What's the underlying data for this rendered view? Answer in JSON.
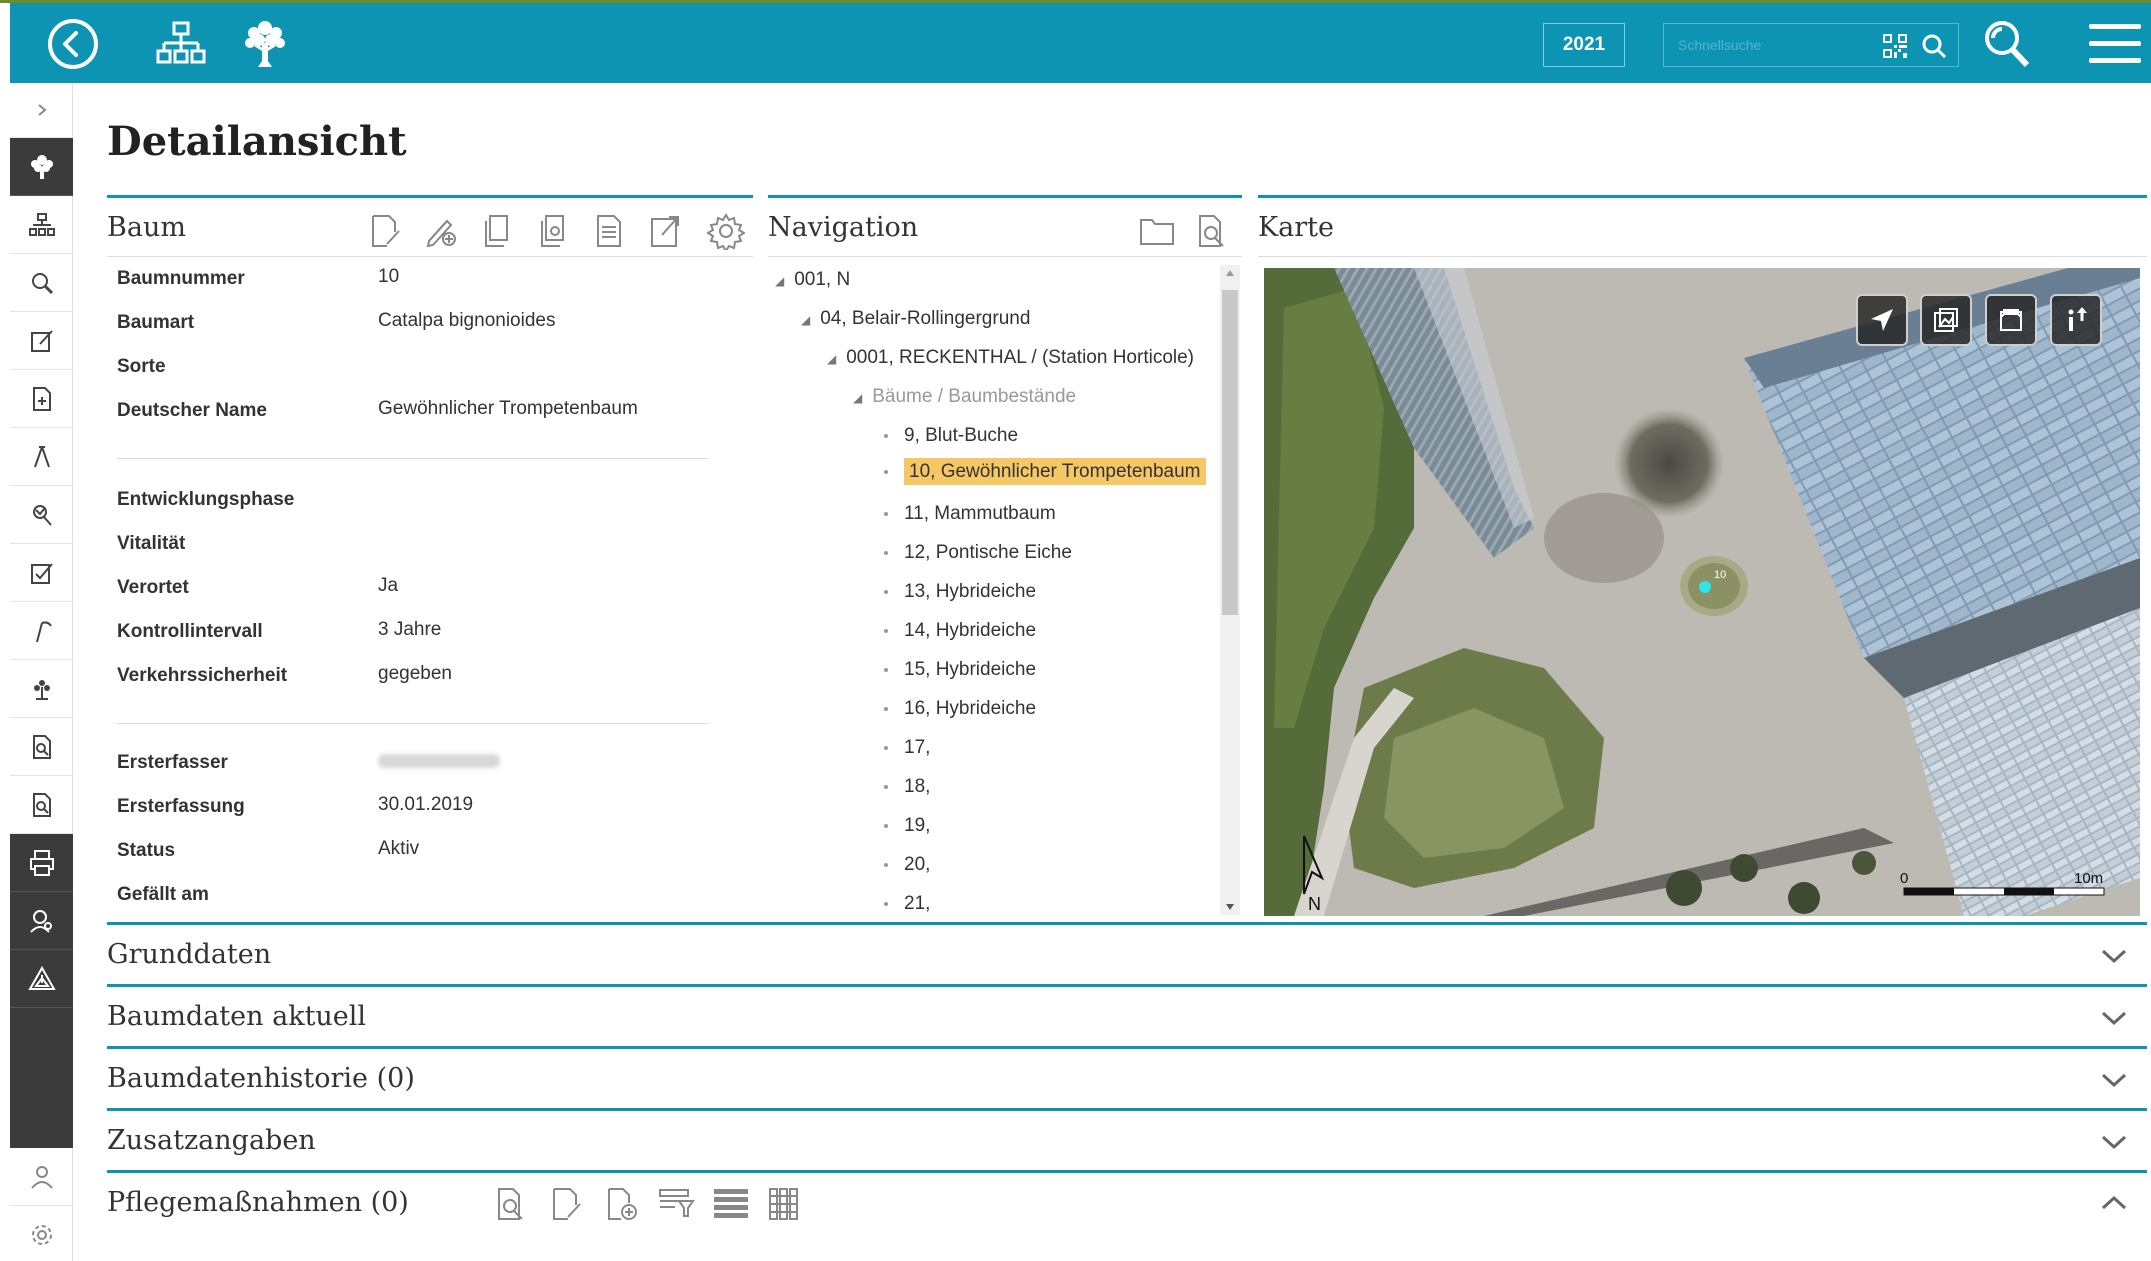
{
  "header": {
    "year": "2021",
    "search_placeholder": "Schnellsuche"
  },
  "page": {
    "title": "Detailansicht"
  },
  "baum_panel": {
    "title": "Baum",
    "fields": [
      {
        "label": "Baumnummer",
        "value": "10"
      },
      {
        "label": "Baumart",
        "value": "Catalpa bignonioides"
      },
      {
        "label": "Sorte",
        "value": ""
      },
      {
        "label": "Deutscher Name",
        "value": "Gewöhnlicher Trompetenbaum"
      },
      {
        "label": "Entwicklungsphase",
        "value": ""
      },
      {
        "label": "Vitalität",
        "value": ""
      },
      {
        "label": "Verortet",
        "value": "Ja"
      },
      {
        "label": "Kontrollintervall",
        "value": "3 Jahre"
      },
      {
        "label": "Verkehrssicherheit",
        "value": "gegeben"
      },
      {
        "label": "Ersterfasser",
        "value": ""
      },
      {
        "label": "Ersterfassung",
        "value": "30.01.2019"
      },
      {
        "label": "Status",
        "value": "Aktiv"
      },
      {
        "label": "Gefällt am",
        "value": ""
      }
    ]
  },
  "navigation_panel": {
    "title": "Navigation",
    "tree": [
      {
        "label": "001, N"
      },
      {
        "label": "04, Belair-Rollingergrund"
      },
      {
        "label": "0001, RECKENTHAL / (Station Horticole)"
      },
      {
        "label": "Bäume / Baumbestände"
      },
      {
        "label": "9, Blut-Buche"
      },
      {
        "label": "10, Gewöhnlicher Trompetenbaum"
      },
      {
        "label": "11, Mammutbaum"
      },
      {
        "label": "12, Pontische Eiche"
      },
      {
        "label": "13, Hybrideiche"
      },
      {
        "label": "14, Hybrideiche"
      },
      {
        "label": "15, Hybrideiche"
      },
      {
        "label": "16, Hybrideiche"
      },
      {
        "label": "17,"
      },
      {
        "label": "18,"
      },
      {
        "label": "19,"
      },
      {
        "label": "20,"
      },
      {
        "label": "21,"
      }
    ]
  },
  "map_panel": {
    "title": "Karte",
    "scale_start": "0",
    "scale_end": "10m",
    "north": "N",
    "marker_label": "10"
  },
  "sections": [
    {
      "title": "Grunddaten"
    },
    {
      "title": "Baumdaten aktuell"
    },
    {
      "title": "Baumdatenhistorie (0)"
    },
    {
      "title": "Zusatzangaben"
    },
    {
      "title": "Pflegemaßnahmen (0)"
    }
  ],
  "colors": {
    "header": "#0d94b3",
    "selected": "#f6c765",
    "sidebar_dark": "#3b3b3b"
  }
}
